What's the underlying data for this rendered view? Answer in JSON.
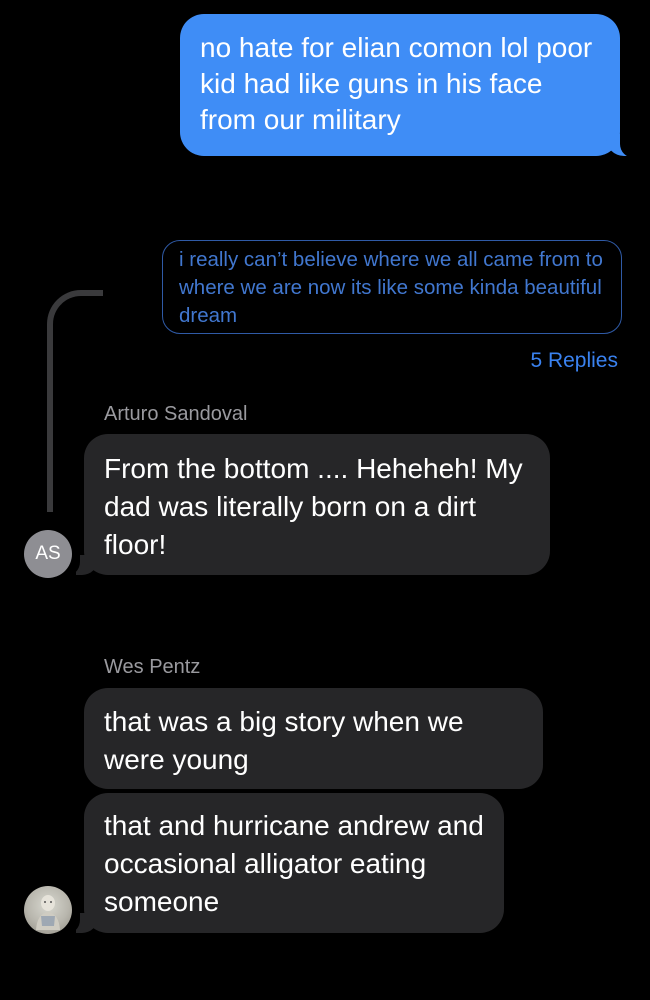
{
  "thread": {
    "sent_message": "no hate for elian comon lol poor kid had like guns in his face from our military",
    "quoted_message": "i really can’t believe where we all came from to where we are now its like some kinda beautiful dream",
    "replies_label": "5 Replies"
  },
  "messages": [
    {
      "sender": "Arturo Sandoval",
      "avatar_initials": "AS",
      "text": "From the bottom .... Heheheh! My dad was literally born on a dirt floor!"
    },
    {
      "sender": "Wes Pentz",
      "text": "that was a big story when we were young"
    },
    {
      "text": "that and hurricane andrew and occasional alligator eating someone"
    }
  ],
  "colors": {
    "sent_bubble": "#3f8df6",
    "received_bubble": "#262628",
    "link_blue": "#3a82f0"
  }
}
